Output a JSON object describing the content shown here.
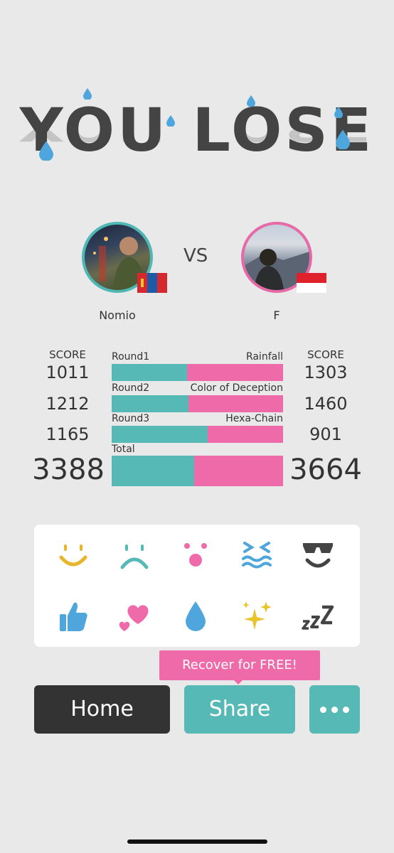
{
  "result_title": "YOU LOSE",
  "vs_label": "VS",
  "players": {
    "left": {
      "name": "Nomio",
      "flag": "Mongolia",
      "color": "#4fb8b5"
    },
    "right": {
      "name": "F",
      "flag": "Indonesia",
      "color": "#e66aa7"
    }
  },
  "score_header": "SCORE",
  "rounds": [
    {
      "label": "Round1",
      "game": "Rainfall",
      "left_score": "1011",
      "right_score": "1303",
      "left_share": 0.44
    },
    {
      "label": "Round2",
      "game": "Color of Deception",
      "left_score": "1212",
      "right_score": "1460",
      "left_share": 0.45
    },
    {
      "label": "Round3",
      "game": "Hexa-Chain",
      "left_score": "1165",
      "right_score": "901",
      "left_share": 0.56
    }
  ],
  "total": {
    "label": "Total",
    "left_score": "3388",
    "right_score": "3664",
    "left_share": 0.48
  },
  "emotes": [
    "smile-emote",
    "sad-emote",
    "surprised-emote",
    "laughing-emote",
    "sunglasses-emote",
    "thumbs-up-emote",
    "hearts-emote",
    "drop-emote",
    "sparkles-emote",
    "sleep-emote"
  ],
  "recover_label": "Recover for FREE!",
  "buttons": {
    "home": "Home",
    "share": "Share"
  },
  "colors": {
    "teal": "#57b9b6",
    "pink": "#ef6aa8",
    "dark": "#333333"
  }
}
